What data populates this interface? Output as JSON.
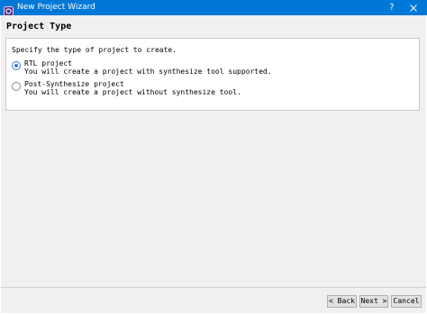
{
  "window": {
    "title": "New Project Wizard",
    "help_label": "?",
    "accent": "#0078d7",
    "icons": {
      "app": "fpga-app-icon",
      "close": "close-icon"
    }
  },
  "page": {
    "title": "Project Type",
    "prompt": "Specify the type of project to create."
  },
  "options": [
    {
      "label": "RTL project",
      "description": "You will create a project with synthesize tool supported.",
      "selected": true
    },
    {
      "label": "Post-Synthesize project",
      "description": "You will create a project without synthesize tool.",
      "selected": false
    }
  ],
  "buttons": {
    "back": "< Back",
    "next": "Next >",
    "cancel": "Cancel"
  }
}
